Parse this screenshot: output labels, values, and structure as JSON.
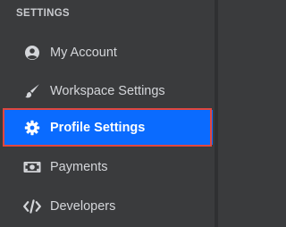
{
  "sidebar": {
    "section_title": "SETTINGS",
    "items": [
      {
        "label": "My Account",
        "icon": "user-circle-icon",
        "active": false
      },
      {
        "label": "Workspace Settings",
        "icon": "paintbrush-icon",
        "active": false
      },
      {
        "label": "Profile Settings",
        "icon": "gear-icon",
        "active": true
      },
      {
        "label": "Payments",
        "icon": "money-bill-icon",
        "active": false
      },
      {
        "label": "Developers",
        "icon": "code-icon",
        "active": false
      }
    ]
  },
  "colors": {
    "background": "#3a3b3d",
    "active_background": "#0a6bff",
    "highlight_outline": "#e0473f",
    "text": "#d4d6da",
    "active_text": "#ffffff"
  }
}
